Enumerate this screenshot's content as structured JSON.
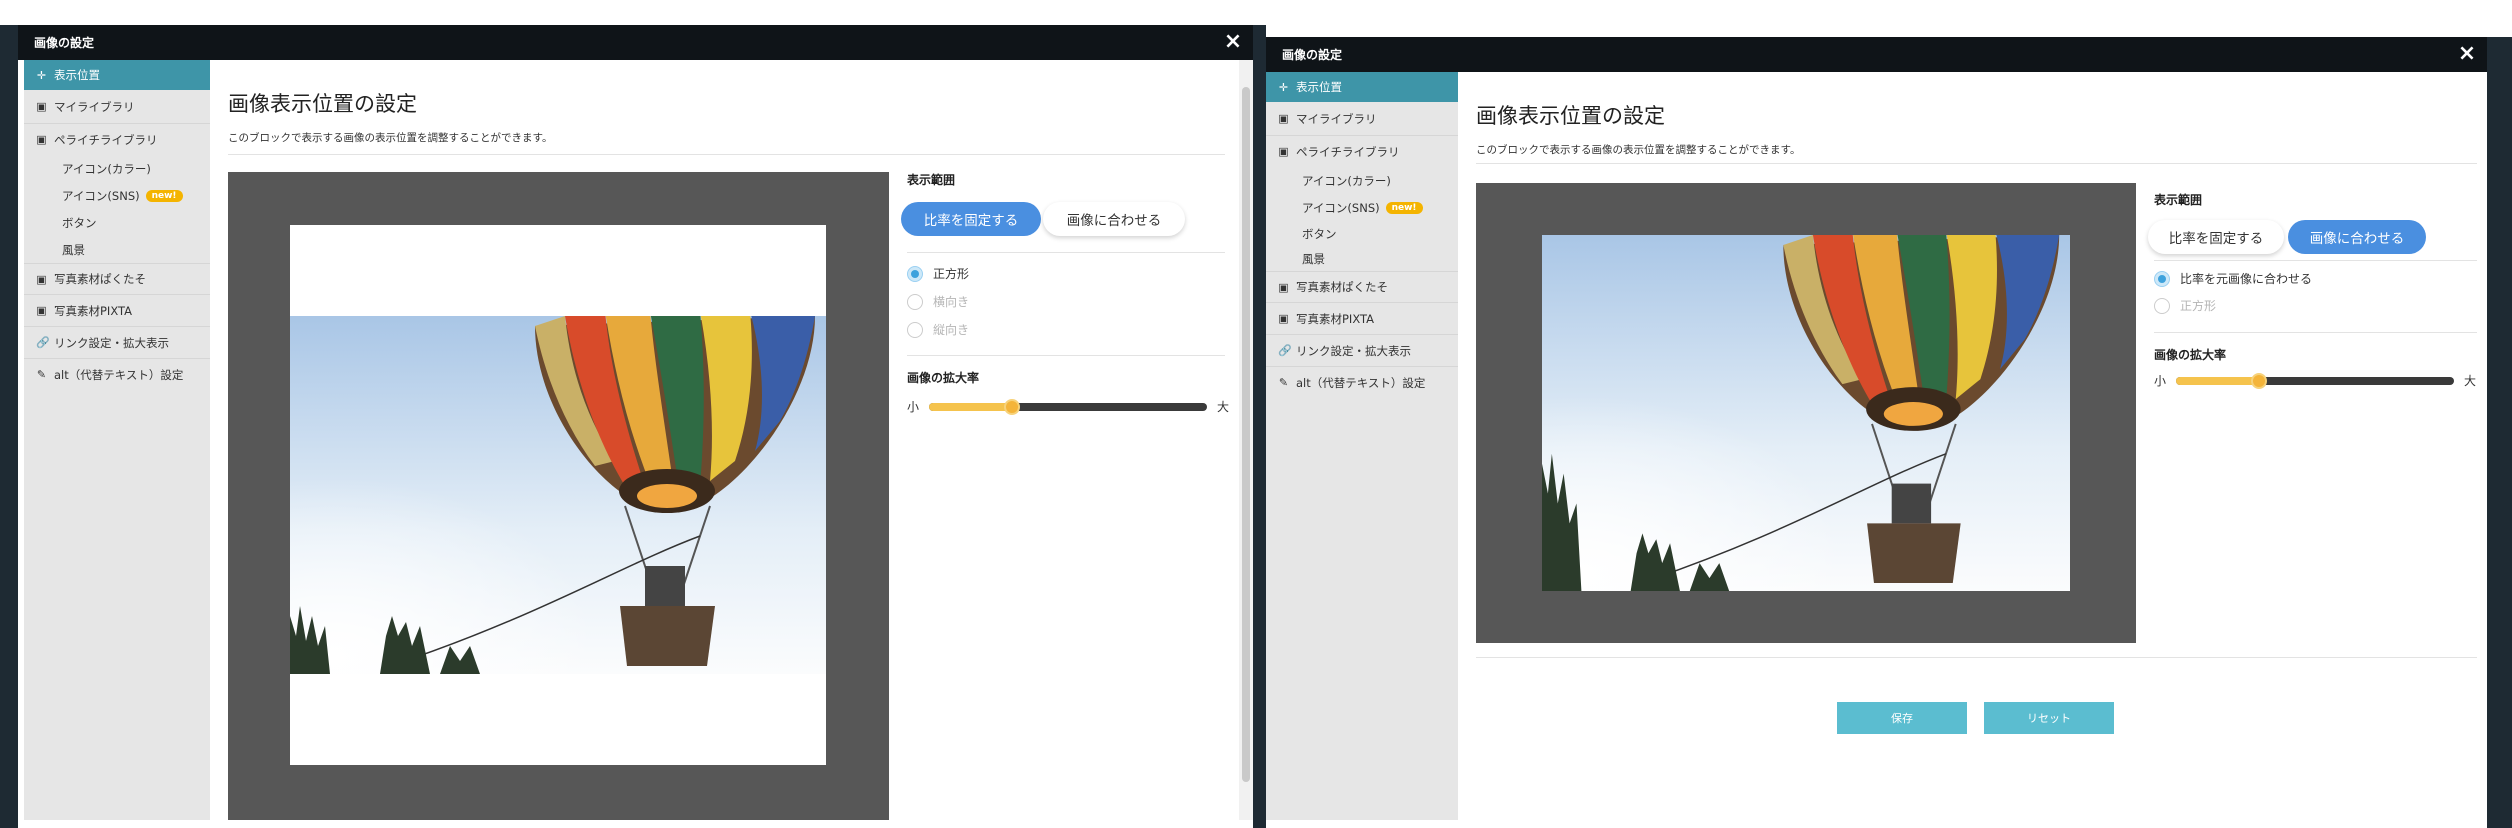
{
  "dialog": {
    "title": "画像の設定",
    "close": "×"
  },
  "sidebar": {
    "items": [
      {
        "label": "表示位置",
        "icon": "move-icon",
        "glyph": "✛"
      },
      {
        "label": "マイライブラリ",
        "icon": "image-icon",
        "glyph": "▣"
      },
      {
        "label": "ペライチライブラリ",
        "icon": "image-icon",
        "glyph": "▣"
      },
      {
        "label": "写真素材ぱくたそ",
        "icon": "image-icon",
        "glyph": "▣"
      },
      {
        "label": "写真素材PIXTA",
        "icon": "image-icon",
        "glyph": "▣"
      },
      {
        "label": "リンク設定・拡大表示",
        "icon": "link-icon",
        "glyph": "🔗"
      },
      {
        "label": "alt（代替テキスト）設定",
        "icon": "pencil-icon",
        "glyph": "✎"
      }
    ],
    "subitems": [
      {
        "label": "アイコン(カラー)"
      },
      {
        "label": "アイコン(SNS)",
        "badge": "new!"
      },
      {
        "label": "ボタン"
      },
      {
        "label": "風景"
      }
    ]
  },
  "main": {
    "title": "画像表示位置の設定",
    "lead": "このブロックで表示する画像の表示位置を調整することができます。",
    "range_label": "表示範囲",
    "fixed_ratio": "比率を固定する",
    "fit_image": "画像に合わせる",
    "zoom_label": "画像の拡大率",
    "small": "小",
    "large": "大"
  },
  "left_panel": {
    "radios": [
      {
        "label": "正方形",
        "selected": true,
        "disabled": false
      },
      {
        "label": "横向き",
        "selected": false,
        "disabled": true
      },
      {
        "label": "縦向き",
        "selected": false,
        "disabled": true
      }
    ],
    "zoom_fraction": 0.3
  },
  "right_panel": {
    "radios": [
      {
        "label": "比率を元画像に合わせる",
        "selected": true,
        "disabled": false
      },
      {
        "label": "正方形",
        "selected": false,
        "disabled": true
      }
    ],
    "zoom_fraction": 0.3,
    "save": "保存",
    "reset": "リセット"
  },
  "colors": {
    "accent": "#3e95a8",
    "pill_active": "#4a8fe0",
    "slider": "#f5c34d",
    "button": "#5bbdd0"
  }
}
